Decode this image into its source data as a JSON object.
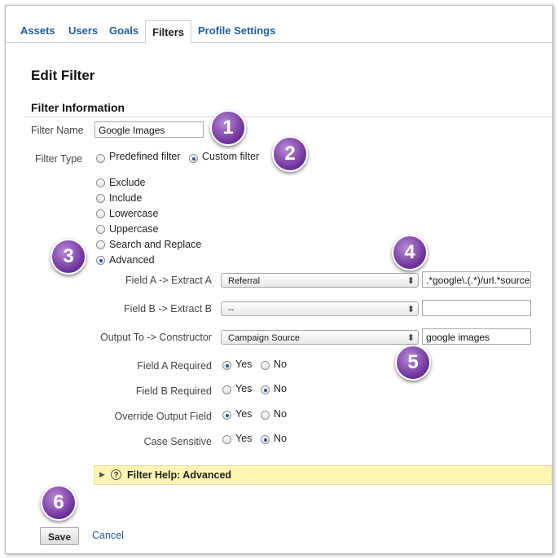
{
  "tabs": [
    {
      "label": "Assets"
    },
    {
      "label": "Users"
    },
    {
      "label": "Goals"
    },
    {
      "label": "Filters",
      "active": true
    },
    {
      "label": "Profile Settings"
    }
  ],
  "page": {
    "title": "Edit Filter",
    "section": "Filter Information"
  },
  "filter_name": {
    "label": "Filter Name",
    "value": "Google Images"
  },
  "filter_type": {
    "label": "Filter Type",
    "options": [
      "Predefined filter",
      "Custom filter"
    ],
    "selected": "Custom filter"
  },
  "custom_types": {
    "options": [
      "Exclude",
      "Include",
      "Lowercase",
      "Uppercase",
      "Search and Replace",
      "Advanced"
    ],
    "selected": "Advanced"
  },
  "field_a": {
    "label": "Field A -> Extract A",
    "select": "Referral",
    "value": ".*google\\.(.*)/url.*source"
  },
  "field_b": {
    "label": "Field B -> Extract B",
    "select": "--",
    "value": ""
  },
  "output": {
    "label": "Output To -> Constructor",
    "select": "Campaign Source",
    "value": "google images"
  },
  "field_a_required": {
    "label": "Field A Required",
    "yes": "Yes",
    "no": "No",
    "selected": "Yes"
  },
  "field_b_required": {
    "label": "Field B Required",
    "yes": "Yes",
    "no": "No",
    "selected": "No"
  },
  "override_output": {
    "label": "Override Output Field",
    "yes": "Yes",
    "no": "No",
    "selected": "Yes"
  },
  "case_sensitive": {
    "label": "Case Sensitive",
    "yes": "Yes",
    "no": "No",
    "selected": "No"
  },
  "help": {
    "label": "Filter Help: Advanced"
  },
  "actions": {
    "save": "Save",
    "cancel": "Cancel"
  },
  "badges": [
    "1",
    "2",
    "3",
    "4",
    "5",
    "6"
  ],
  "colors": {
    "link": "#1f5c9e",
    "radio_selected": "#1e56b2",
    "help_bar": "#fff6b3",
    "badge": "#6b2e98"
  }
}
